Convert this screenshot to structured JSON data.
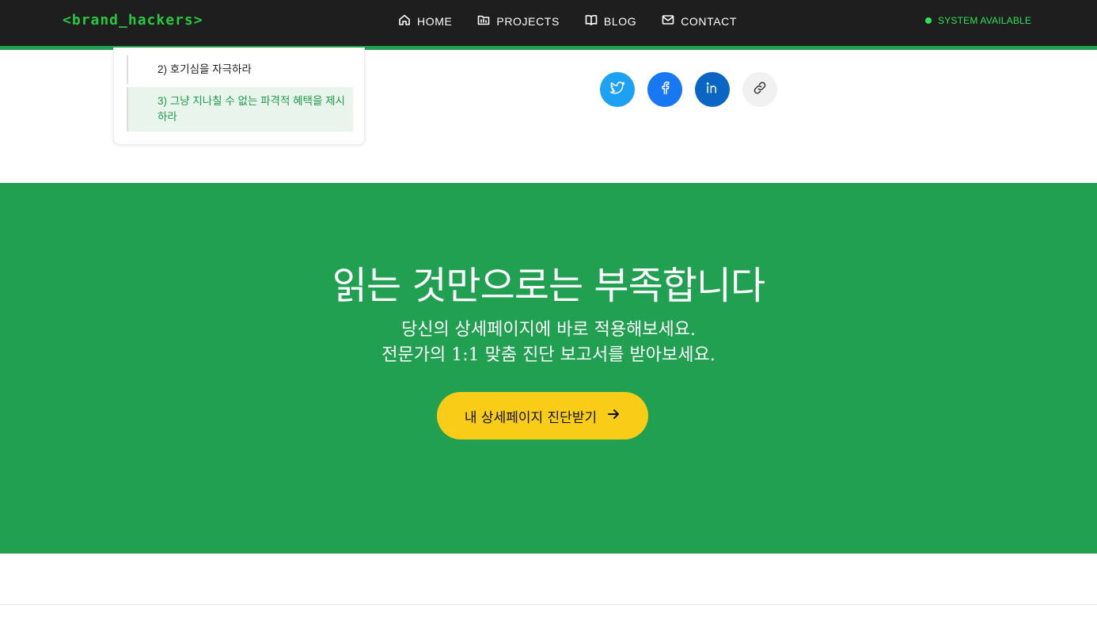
{
  "header": {
    "brand": "<brand_hackers>",
    "nav": [
      {
        "label": "HOME",
        "icon": "home-icon"
      },
      {
        "label": "PROJECTS",
        "icon": "folder-icon"
      },
      {
        "label": "BLOG",
        "icon": "book-icon"
      },
      {
        "label": "CONTACT",
        "icon": "mail-icon"
      }
    ],
    "status": "SYSTEM AVAILABLE"
  },
  "toc": {
    "items": [
      {
        "label": "2) 호기심을 자극하라",
        "active": false
      },
      {
        "label": "3) 그냥 지나칠 수 없는 파격적 혜택을 제시하라",
        "active": true
      }
    ]
  },
  "share": [
    {
      "name": "twitter",
      "icon": "twitter-icon"
    },
    {
      "name": "facebook",
      "icon": "facebook-icon"
    },
    {
      "name": "linkedin",
      "icon": "linkedin-icon"
    },
    {
      "name": "copy-link",
      "icon": "link-icon"
    }
  ],
  "cta": {
    "title": "읽는 것만으로는 부족합니다",
    "subtitle_line1": "당신의 상세페이지에 바로 적용해보세요.",
    "subtitle_line2": "전문가의 1:1 맞춤 진단 보고서를 받아보세요.",
    "button_label": "내 상세페이지 진단받기"
  },
  "colors": {
    "header_bg": "#1e1e1e",
    "brand_green": "#28c840",
    "status_green": "#31e05a",
    "cta_green": "#22a052",
    "cta_button": "#f8cc17"
  }
}
